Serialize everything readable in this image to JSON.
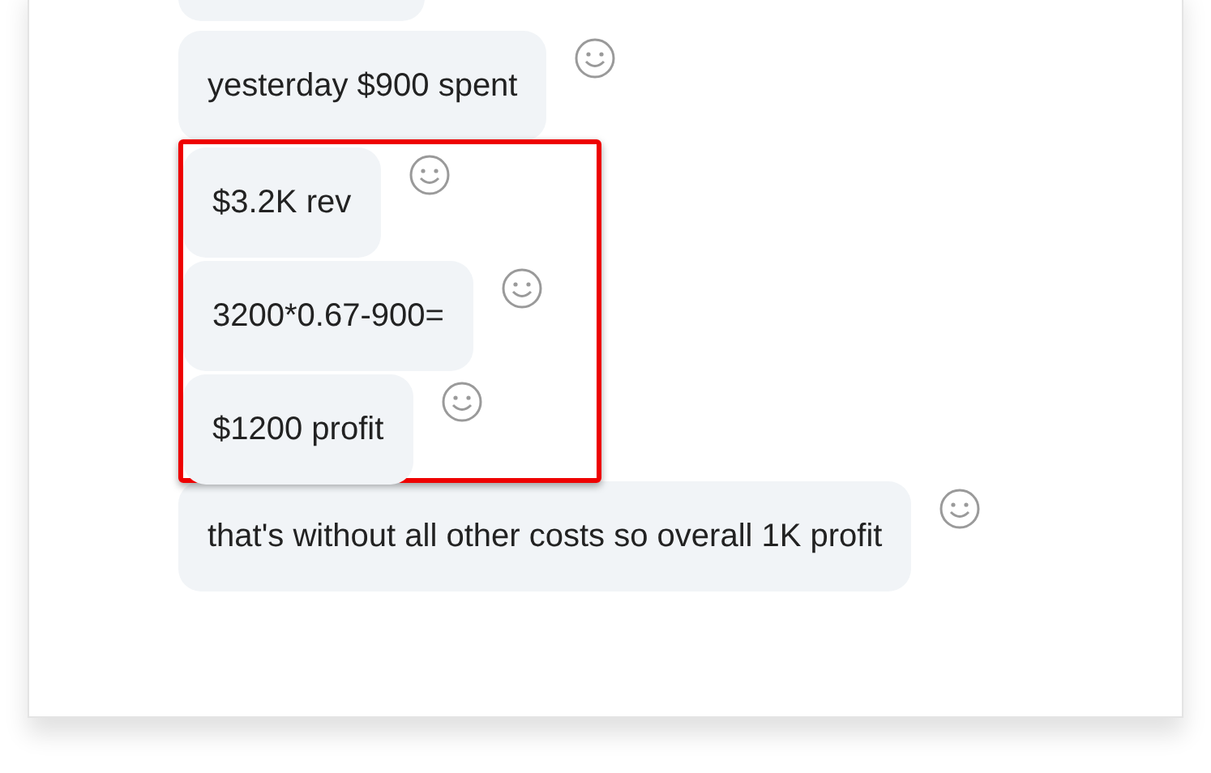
{
  "messages": [
    {
      "text": "yesterday $900 spent",
      "highlighted": false
    },
    {
      "text": "$3.2K rev",
      "highlighted": true
    },
    {
      "text": "3200*0.67-900=",
      "highlighted": true
    },
    {
      "text": "$1200 profit",
      "highlighted": true
    },
    {
      "text": "that's without all other costs so overall 1K profit",
      "highlighted": false
    }
  ]
}
